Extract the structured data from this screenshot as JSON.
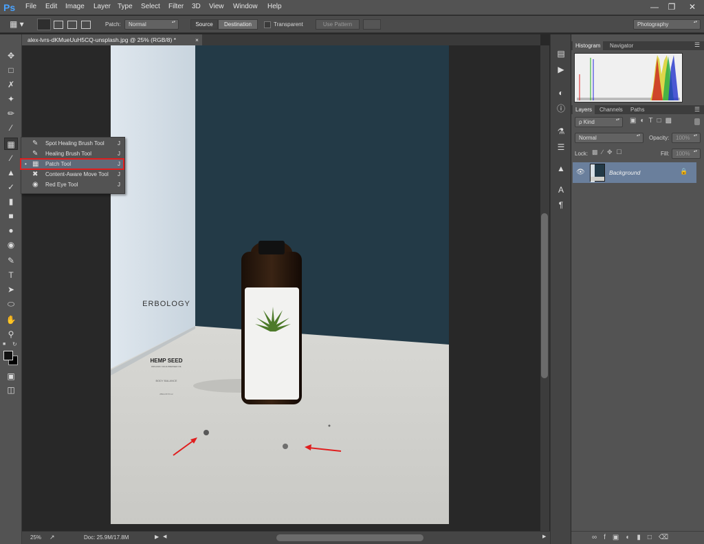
{
  "app": {
    "logo": "Ps"
  },
  "menu": [
    "File",
    "Edit",
    "Image",
    "Layer",
    "Type",
    "Select",
    "Filter",
    "3D",
    "View",
    "Window",
    "Help"
  ],
  "window_controls": {
    "minimize": "—",
    "restore": "❐",
    "close": "✕"
  },
  "options": {
    "patch_label": "Patch:",
    "patch_mode": "Normal",
    "source": "Source",
    "destination": "Destination",
    "transparent_label": "Transparent",
    "use_pattern": "Use Pattern",
    "workspace": "Photography"
  },
  "document": {
    "tab_title": "alex-lvrs-dKMueUuH5CQ-unsplash.jpg @ 25% (RGB/8) *",
    "close": "×"
  },
  "flyout": {
    "items": [
      {
        "label": "Spot Healing Brush Tool",
        "key": "J",
        "icon": "spot-healing-icon",
        "selected": false
      },
      {
        "label": "Healing Brush Tool",
        "key": "J",
        "icon": "healing-brush-icon",
        "selected": false
      },
      {
        "label": "Patch Tool",
        "key": "J",
        "icon": "patch-icon",
        "selected": true
      },
      {
        "label": "Content-Aware Move Tool",
        "key": "J",
        "icon": "content-aware-move-icon",
        "selected": false
      },
      {
        "label": "Red Eye Tool",
        "key": "J",
        "icon": "red-eye-icon",
        "selected": false
      }
    ]
  },
  "photo": {
    "brand": "ERBOLOGY",
    "product": "HEMP SEED",
    "line1": "ORGANIC COLD-PRESSED OIL",
    "line2": "BODY BALANCE",
    "size": "250ml   8.5 fl oz"
  },
  "status": {
    "zoom": "25%",
    "doc": "Doc: 25.9M/17.8M"
  },
  "histogram": {
    "tabs": [
      "Histogram",
      "Navigator"
    ]
  },
  "layers": {
    "tabs": [
      "Layers",
      "Channels",
      "Paths"
    ],
    "kind": "ρ Kind",
    "blend": "Normal",
    "opacity_label": "Opacity:",
    "opacity": "100%",
    "lock_label": "Lock:",
    "fill_label": "Fill:",
    "fill": "100%",
    "items": [
      {
        "name": "Background",
        "locked": true,
        "visible": true
      }
    ]
  },
  "colors": {
    "accent_red": "#e01e1e",
    "selection": "#6a7f9c",
    "photo_wall": "#233a47"
  }
}
